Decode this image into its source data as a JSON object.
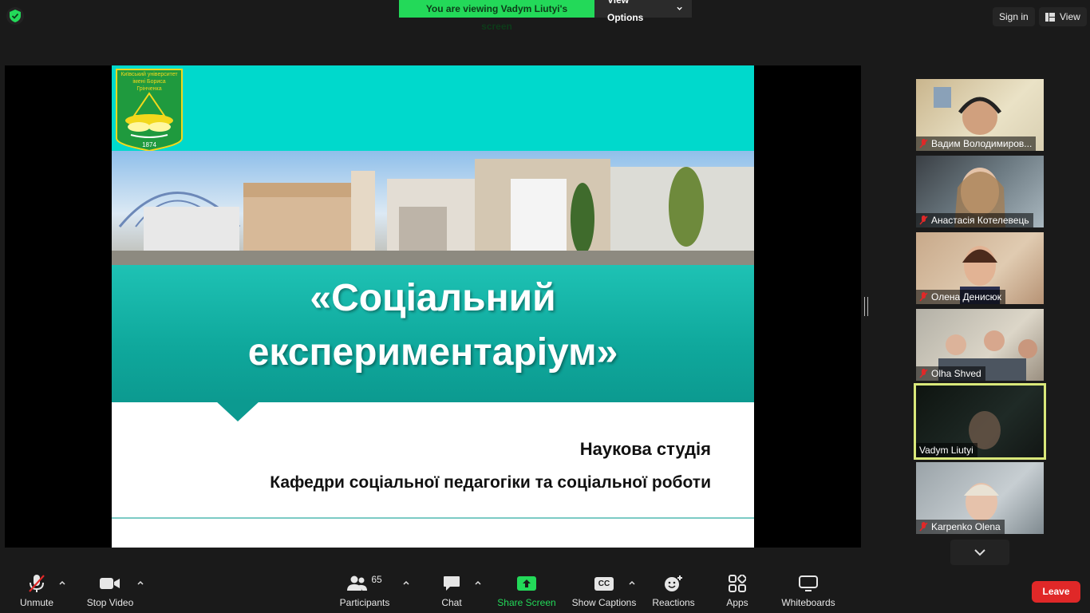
{
  "topbar": {
    "viewing_banner": "You are viewing Vadym Liutyi's screen",
    "view_options": "View Options",
    "sign_in": "Sign in",
    "view": "View"
  },
  "slide": {
    "logo_text_line1": "Київський університет",
    "logo_text_line2": "імені Бориса Грінченка",
    "logo_year": "1874",
    "title_line1": "«Соціальний",
    "title_line2": "експериментаріум»",
    "subtitle1": "Наукова студія",
    "subtitle2": "Кафедри соціальної педагогіки та соціальної роботи"
  },
  "gallery": {
    "participants": [
      {
        "name": "Вадим Володимиров...",
        "muted": true
      },
      {
        "name": "Анастасія Котелевець",
        "muted": true
      },
      {
        "name": "Олена Денисюк",
        "muted": true
      },
      {
        "name": "Olha Shved",
        "muted": true
      },
      {
        "name": "Vadym Liutyi",
        "muted": false,
        "active": true
      },
      {
        "name": "Karpenko Olena",
        "muted": true
      }
    ]
  },
  "toolbar": {
    "unmute": "Unmute",
    "stop_video": "Stop Video",
    "participants": "Participants",
    "participants_count": "65",
    "chat": "Chat",
    "share_screen": "Share Screen",
    "show_captions": "Show Captions",
    "cc": "CC",
    "reactions": "Reactions",
    "apps": "Apps",
    "whiteboards": "Whiteboards",
    "leave": "Leave"
  },
  "colors": {
    "share_green": "#23d959",
    "leave_red": "#e02828",
    "active_speaker": "#d9e87a",
    "slide_teal": "#0fa89c",
    "slide_cyan": "#00d9cc"
  }
}
